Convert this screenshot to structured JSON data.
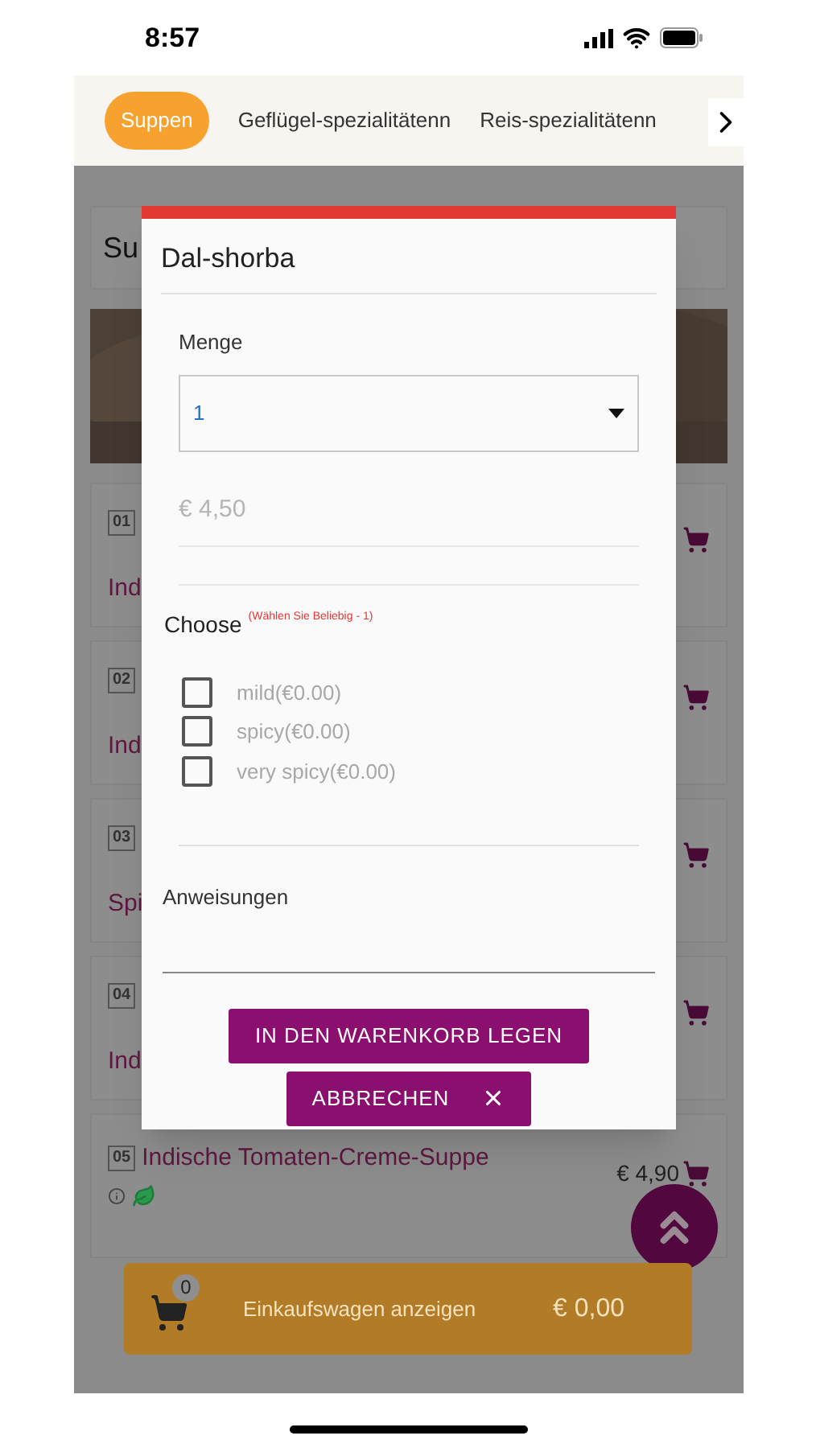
{
  "status_bar": {
    "time": "8:57"
  },
  "categories": {
    "tabs": [
      {
        "label": "Suppen",
        "selected": true
      },
      {
        "label": "Geflügel-spezialitätenn",
        "selected": false
      },
      {
        "label": "Reis-spezialitätenn",
        "selected": false
      }
    ]
  },
  "background": {
    "heading": "Su",
    "items": [
      {
        "number": "01",
        "name": "Ind"
      },
      {
        "number": "02",
        "name": "Ind"
      },
      {
        "number": "03",
        "name": "Spi"
      },
      {
        "number": "04",
        "name": "Ind"
      },
      {
        "number": "05",
        "name": "Indische Tomaten-Creme-Suppe",
        "price": "€ 4,90",
        "vegetarian": true
      }
    ]
  },
  "cart_bar": {
    "count": "0",
    "label": "Einkaufswagen anzeigen",
    "total": "€ 0,00"
  },
  "dialog": {
    "title": "Dal-shorba",
    "quantity": {
      "label": "Menge",
      "value": "1"
    },
    "price": "€ 4,50",
    "options": {
      "title": "Choose",
      "hint": "(Wählen Sie Beliebig - 1)",
      "items": [
        {
          "label": "mild(€0.00)",
          "checked": false
        },
        {
          "label": "spicy(€0.00)",
          "checked": false
        },
        {
          "label": "very spicy(€0.00)",
          "checked": false
        }
      ]
    },
    "instructions": {
      "label": "Anweisungen"
    },
    "buttons": [
      {
        "label": "IN DEN WARENKORB LEGEN",
        "kind": "primary"
      },
      {
        "label": "ABBRECHEN",
        "kind": "cancel"
      }
    ]
  }
}
